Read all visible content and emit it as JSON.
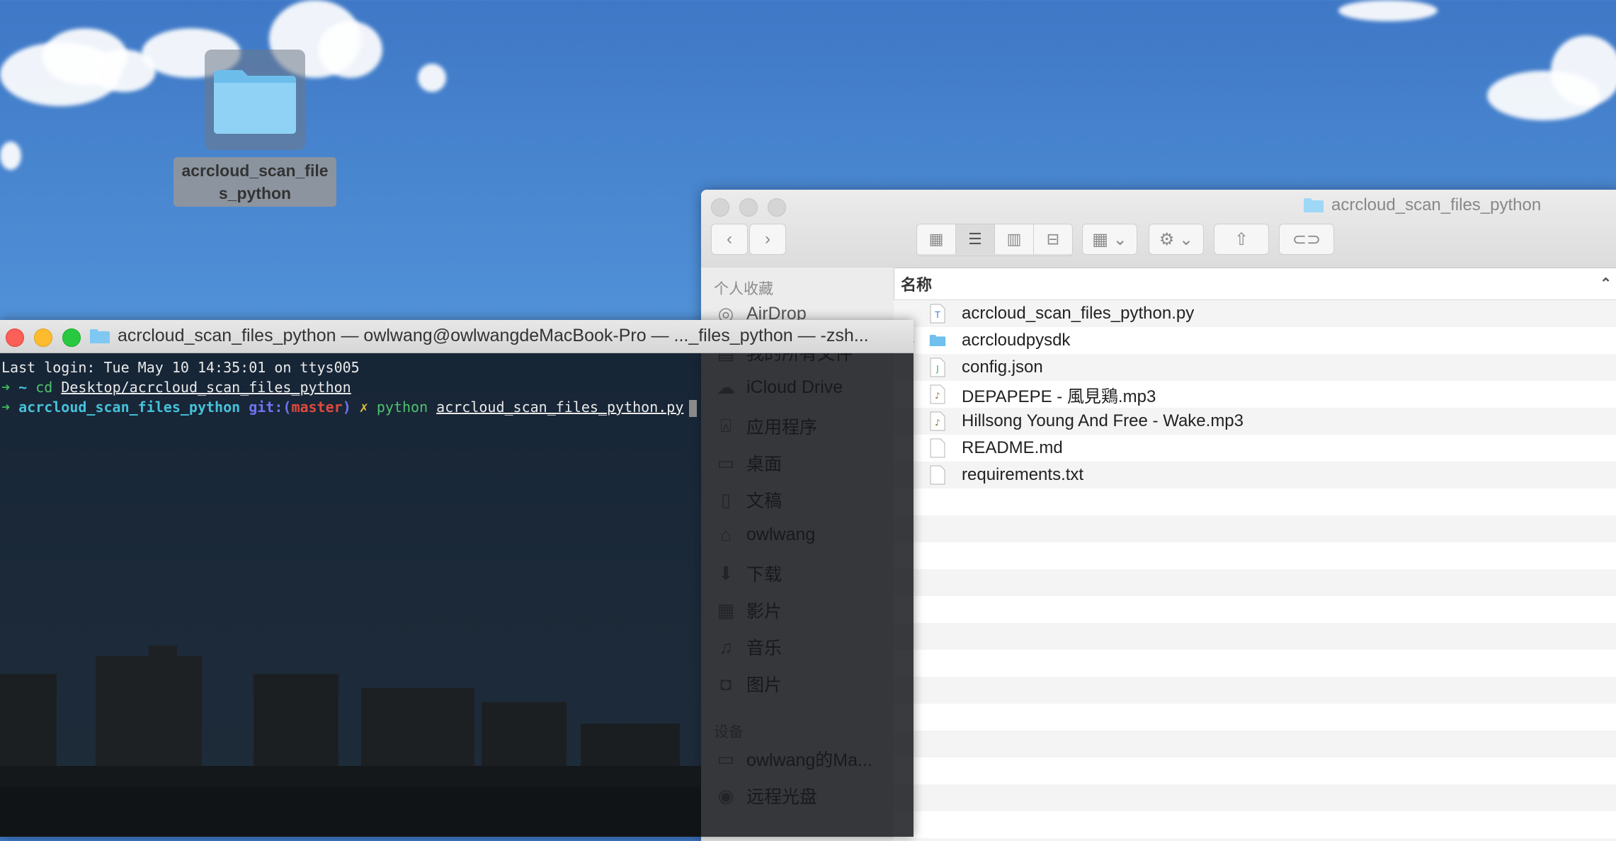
{
  "desktop": {
    "folder_icon_label": "acrcloud_scan_files_python"
  },
  "finder": {
    "title": "acrcloud_scan_files_python",
    "toolbar": {
      "back": "back-icon",
      "forward": "forward-icon",
      "views": [
        "icon-view-icon",
        "list-view-icon",
        "column-view-icon",
        "coverflow-view-icon"
      ],
      "active_view": "list"
    },
    "sidebar": {
      "favorites_header": "个人收藏",
      "favorites": [
        {
          "label": "AirDrop",
          "icon": "airdrop-icon"
        },
        {
          "label": "我的所有文件",
          "icon": "all-files-icon"
        },
        {
          "label": "iCloud Drive",
          "icon": "cloud-icon"
        },
        {
          "label": "应用程序",
          "icon": "applications-icon"
        },
        {
          "label": "桌面",
          "icon": "desktop-icon"
        },
        {
          "label": "文稿",
          "icon": "documents-icon"
        },
        {
          "label": "owlwang",
          "icon": "home-icon"
        },
        {
          "label": "下载",
          "icon": "downloads-icon"
        },
        {
          "label": "影片",
          "icon": "movies-icon"
        },
        {
          "label": "音乐",
          "icon": "music-icon"
        },
        {
          "label": "图片",
          "icon": "pictures-icon"
        }
      ],
      "devices_header": "设备",
      "devices": [
        {
          "label": "owlwang的Ma...",
          "icon": "laptop-icon"
        },
        {
          "label": "远程光盘",
          "icon": "disc-icon"
        }
      ]
    },
    "list": {
      "column_header": "名称",
      "files": [
        {
          "name": "acrcloud_scan_files_python.py",
          "icon": "python-file-icon",
          "folder": false
        },
        {
          "name": "acrcloudpysdk",
          "icon": "folder-icon",
          "folder": true
        },
        {
          "name": "config.json",
          "icon": "json-file-icon",
          "folder": false
        },
        {
          "name": "DEPAPEPE - 風見鶏.mp3",
          "icon": "mp3-file-icon",
          "folder": false
        },
        {
          "name": "Hillsong Young And Free - Wake.mp3",
          "icon": "mp3-file-icon",
          "folder": false
        },
        {
          "name": "README.md",
          "icon": "text-file-icon",
          "folder": false
        },
        {
          "name": "requirements.txt",
          "icon": "text-file-icon",
          "folder": false
        }
      ]
    }
  },
  "terminal": {
    "title": "acrcloud_scan_files_python — owlwang@owlwangdeMacBook-Pro — ..._files_python — -zsh...",
    "lines": {
      "login": "Last login: Tue May 10 14:35:01 on ttys005",
      "prompt1_arrow": "➜",
      "prompt1_tilde": "~",
      "prompt1_cmd": "cd",
      "prompt1_arg": "Desktop/acrcloud_scan_files_python",
      "prompt2_arrow": "➜",
      "prompt2_dir": "acrcloud_scan_files_python",
      "prompt2_git": "git:(",
      "prompt2_branch": "master",
      "prompt2_git_close": ")",
      "prompt2_x": "✗",
      "prompt2_cmd": "python",
      "prompt2_arg": "acrcloud_scan_files_python.py"
    }
  }
}
